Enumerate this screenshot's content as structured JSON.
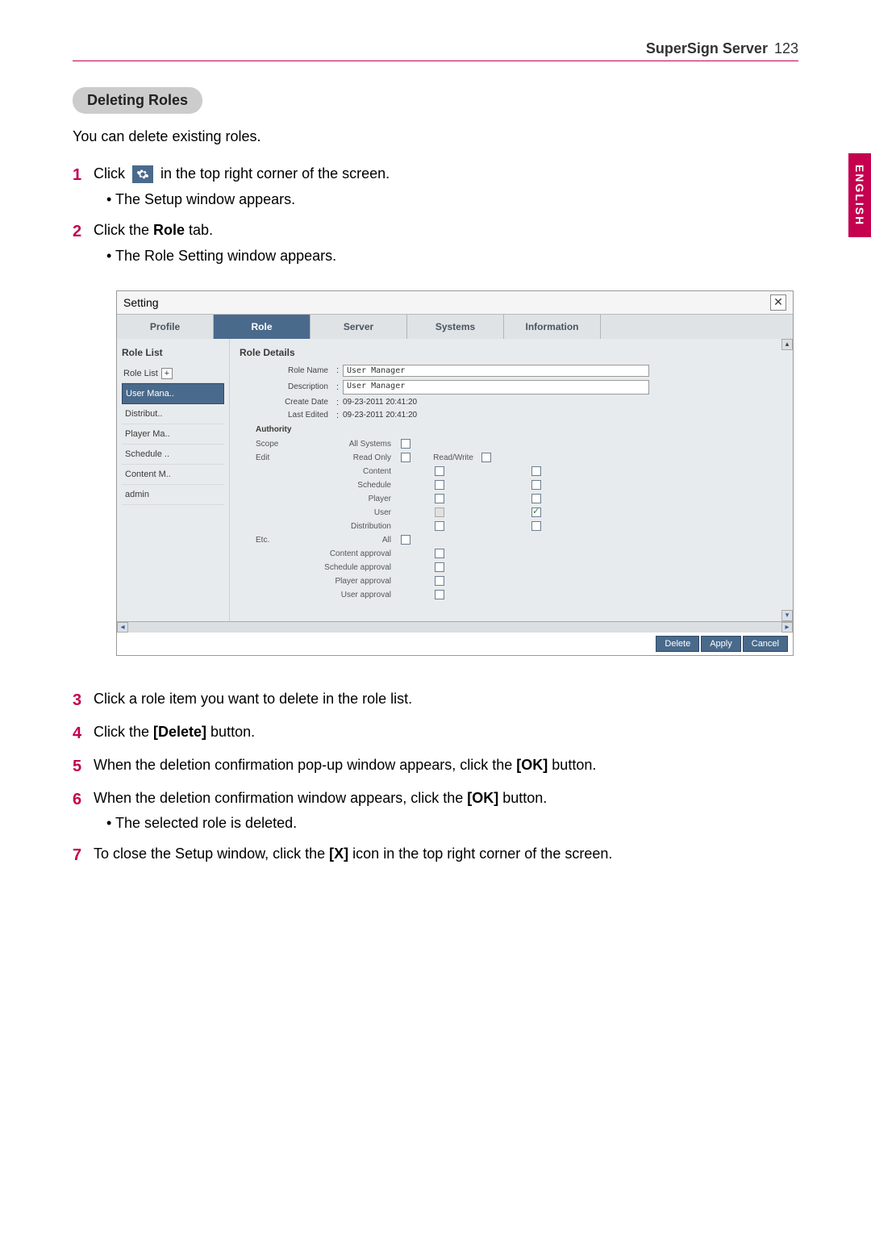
{
  "header": {
    "label": "SuperSign Server",
    "page_num": "123"
  },
  "lang_tab": "ENGLISH",
  "section_title": "Deleting Roles",
  "intro_text": "You can delete existing roles.",
  "steps_top": [
    {
      "num": "1",
      "pre": "Click ",
      "post": " in the top right corner of the screen.",
      "subs": [
        "The Setup window appears."
      ]
    },
    {
      "num": "2",
      "pre": "Click the ",
      "bold": "Role",
      "post": " tab.",
      "subs": [
        "The Role Setting window appears."
      ]
    }
  ],
  "setting_window": {
    "title": "Setting",
    "tabs": [
      "Profile",
      "Role",
      "Server",
      "Systems",
      "Information"
    ],
    "active_tab": 1,
    "role_list_head": "Role List",
    "role_list_label": "Role List",
    "role_items": [
      "User Mana..",
      "Distribut..",
      "Player Ma..",
      "Schedule ..",
      "Content M..",
      "admin"
    ],
    "selected_item": 0,
    "role_details_head": "Role Details",
    "fields": {
      "role_name_label": "Role Name",
      "role_name_value": "User Manager",
      "description_label": "Description",
      "description_value": "User Manager",
      "create_date_label": "Create Date",
      "create_date_value": "09-23-2011 20:41:20",
      "last_edited_label": "Last Edited",
      "last_edited_value": "09-23-2011 20:41:20"
    },
    "authority_head": "Authority",
    "scope_label": "Scope",
    "all_systems_label": "All Systems",
    "edit_label": "Edit",
    "read_only_label": "Read Only",
    "read_write_label": "Read/Write",
    "auth_rows": [
      {
        "label": "Content",
        "ro": false,
        "rw": false
      },
      {
        "label": "Schedule",
        "ro": false,
        "rw": false
      },
      {
        "label": "Player",
        "ro": false,
        "rw": false
      },
      {
        "label": "User",
        "ro": "disabled",
        "rw": true
      },
      {
        "label": "Distribution",
        "ro": false,
        "rw": false
      }
    ],
    "etc_label": "Etc.",
    "all_label": "All",
    "etc_rows": [
      {
        "label": "Content approval",
        "chk": false
      },
      {
        "label": "Schedule approval",
        "chk": false
      },
      {
        "label": "Player approval",
        "chk": false
      },
      {
        "label": "User approval",
        "chk": false
      }
    ],
    "buttons": {
      "delete": "Delete",
      "apply": "Apply",
      "cancel": "Cancel"
    }
  },
  "steps_bottom": [
    {
      "num": "3",
      "segs": [
        {
          "t": "Click a role item you want to delete in the role list."
        }
      ],
      "subs": []
    },
    {
      "num": "4",
      "segs": [
        {
          "t": "Click the "
        },
        {
          "b": "[Delete]"
        },
        {
          "t": " button."
        }
      ],
      "subs": []
    },
    {
      "num": "5",
      "segs": [
        {
          "t": "When the deletion confirmation pop-up window appears, click the "
        },
        {
          "b": "[OK]"
        },
        {
          "t": " button."
        }
      ],
      "subs": []
    },
    {
      "num": "6",
      "segs": [
        {
          "t": "When the deletion confirmation window appears, click the "
        },
        {
          "b": "[OK]"
        },
        {
          "t": " button."
        }
      ],
      "subs": [
        "The selected role is deleted."
      ]
    },
    {
      "num": "7",
      "segs": [
        {
          "t": "To close the Setup window, click the "
        },
        {
          "b": "[X]"
        },
        {
          "t": " icon in the top right corner of the screen."
        }
      ],
      "subs": []
    }
  ]
}
